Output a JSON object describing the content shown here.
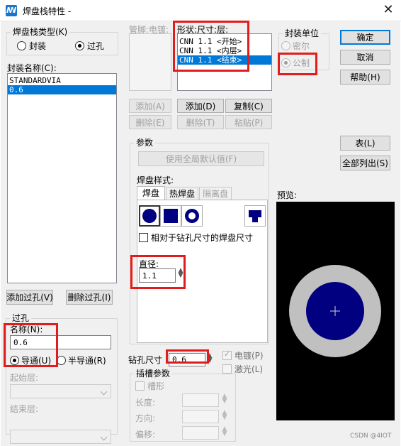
{
  "window": {
    "title": "焊盘栈特性 -",
    "close": "✕"
  },
  "stack_type": {
    "title": "焊盘栈类型(K)",
    "options": [
      {
        "label": "封装",
        "selected": false
      },
      {
        "label": "过孔",
        "selected": true
      }
    ]
  },
  "footprint_name": {
    "label": "封装名称(C):",
    "items": [
      "STANDARDVIA",
      "0.6"
    ],
    "selected_index": 1
  },
  "pin_electrical": {
    "label": "管脚:电镀:"
  },
  "shape_size_layer": {
    "label": "形状:尺寸:层:",
    "items": [
      "CNN 1.1 <开始>",
      "CNN 1.1 <内层>",
      "CNN 1.1 <结束>"
    ],
    "selected_index": 2
  },
  "package_unit": {
    "title": "封装单位",
    "options": [
      {
        "label": "密尔",
        "selected": false
      },
      {
        "label": "公制",
        "selected": true
      }
    ]
  },
  "buttons": {
    "ok": "确定",
    "cancel": "取消",
    "help": "帮助(H)",
    "table": "表(L)",
    "list_all": "全部列出(S)",
    "add_left": "添加(A)",
    "delete_left": "删除(E)",
    "add_right": "添加(D)",
    "copy": "复制(C)",
    "delete_right": "删除(T)",
    "paste": "粘贴(P)",
    "add_via": "添加过孔(V)",
    "delete_via": "删除过孔(I)"
  },
  "params": {
    "title": "参数",
    "use_default": "使用全局默认值(F)",
    "pad_style_label": "焊盘样式:",
    "tabs": [
      "焊盘",
      "热焊盘",
      "隔离盘"
    ],
    "active_tab": 0,
    "relative_drill_label": "相对于钻孔尺寸的焊盘尺寸",
    "diameter_label": "直径:",
    "diameter_value": "1.1"
  },
  "via": {
    "title": "过孔",
    "name_label": "名称(N):",
    "name_value": "0.6",
    "options": [
      {
        "label": "导通(U)",
        "selected": true
      },
      {
        "label": "半导通(R)",
        "selected": false
      }
    ],
    "start_layer_label": "起始层:",
    "end_layer_label": "结束层:"
  },
  "drill": {
    "size_label": "钻孔尺寸",
    "size_value": "0.6",
    "plated_label": "电镀(P)",
    "plated_checked": true,
    "laser_label": "激光(L)",
    "laser_checked": false
  },
  "slot": {
    "title": "插槽参数",
    "slotted_label": "槽形",
    "length_label": "长度:",
    "direction_label": "方向:",
    "offset_label": "偏移:"
  },
  "preview": {
    "label": "预览:",
    "outer_color": "#c0c0c0",
    "inner_color": "#000080",
    "background": "#000000"
  },
  "watermark": "CSDN @4IOT"
}
